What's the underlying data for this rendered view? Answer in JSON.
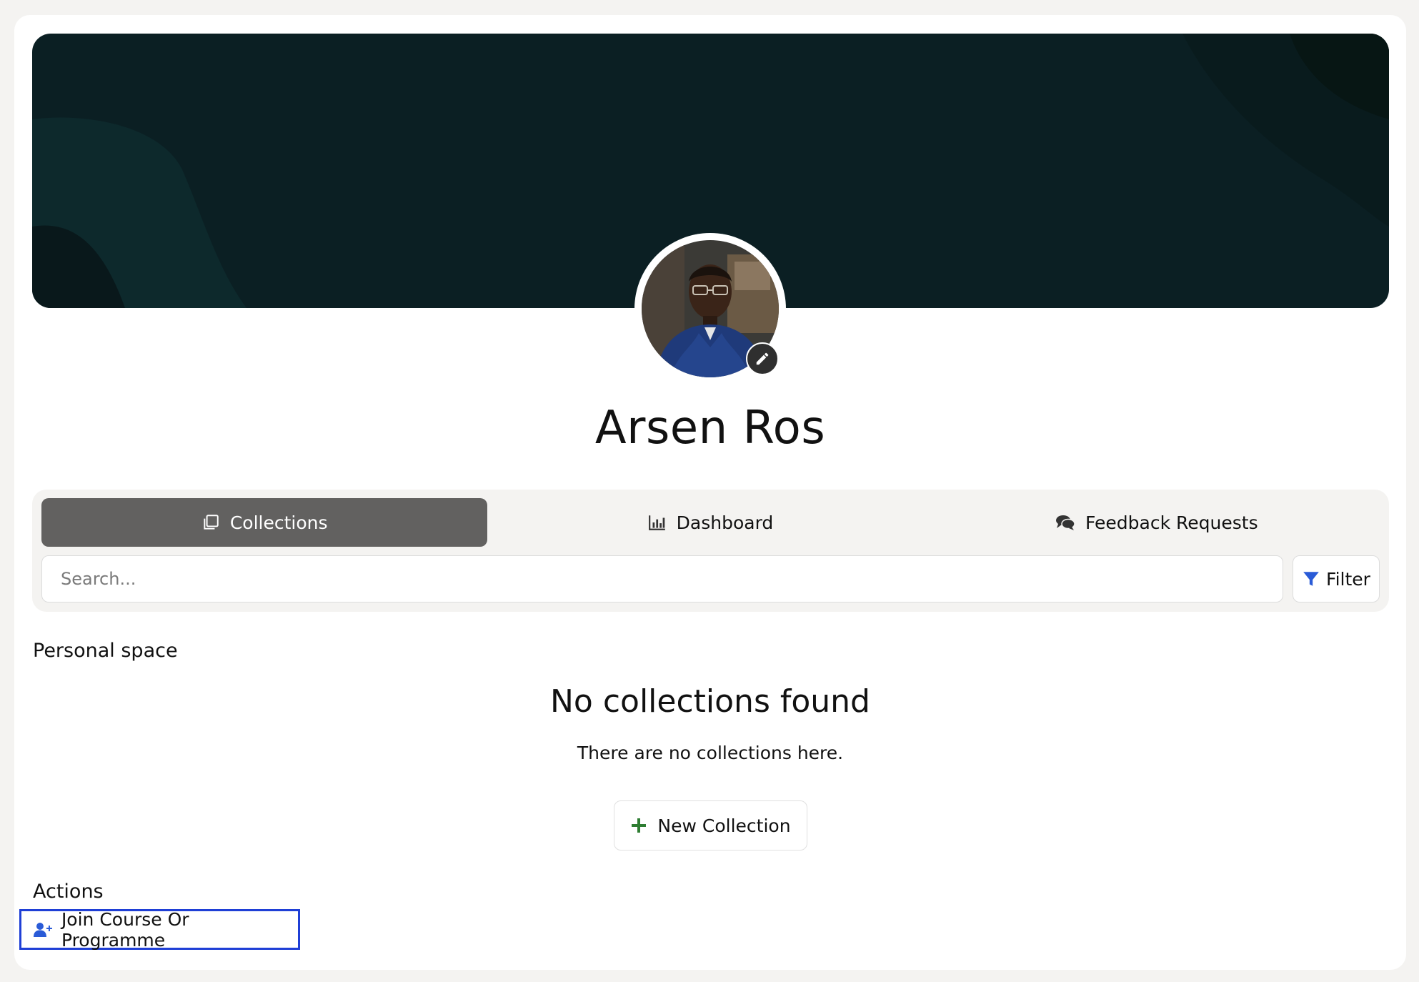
{
  "profile": {
    "name": "Arsen Ros",
    "avatar_icon": "user-photo",
    "edit_icon": "pencil-icon"
  },
  "tabs": [
    {
      "label": "Collections",
      "icon": "collections-icon",
      "active": true
    },
    {
      "label": "Dashboard",
      "icon": "bar-chart-icon",
      "active": false
    },
    {
      "label": "Feedback Requests",
      "icon": "comments-icon",
      "active": false
    }
  ],
  "search": {
    "placeholder": "Search..."
  },
  "filter": {
    "label": "Filter",
    "icon": "funnel-icon"
  },
  "personal_space": {
    "title": "Personal space",
    "empty_title": "No collections found",
    "empty_message": "There are no collections here.",
    "new_button": "New Collection"
  },
  "actions": {
    "title": "Actions",
    "join_label": "Join Course Or Programme",
    "join_icon": "user-plus-icon"
  },
  "colors": {
    "banner": "#0b1f23",
    "active_tab": "#626160",
    "accent_blue": "#2a5bd7",
    "plus_green": "#2e7d32",
    "highlight": "#1f3fd6"
  }
}
